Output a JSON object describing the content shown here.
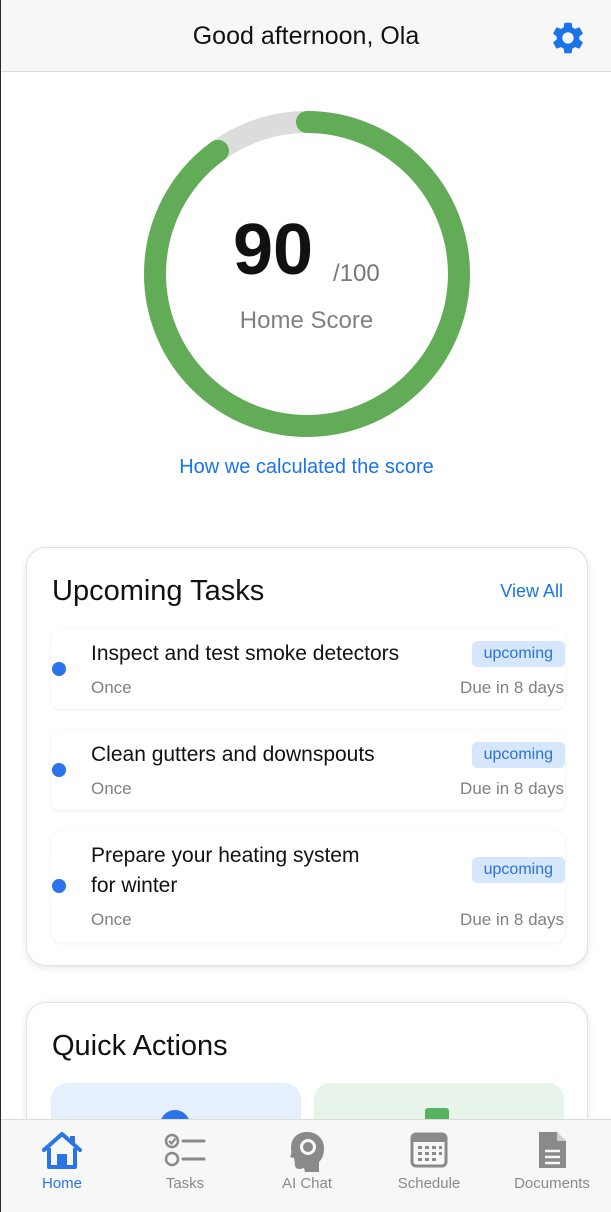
{
  "header": {
    "title": "Good afternoon, Ola",
    "settings_icon": "gear-icon"
  },
  "score": {
    "value": "90",
    "max_label": "/100",
    "label": "Home Score",
    "fraction": 0.9,
    "link": "How we calculated the score"
  },
  "colors": {
    "accent": "#1a73e8",
    "score_green": "#62ac57",
    "track_gray": "#dcdcdc",
    "badge_bg": "#d6e6fb"
  },
  "upcoming": {
    "title": "Upcoming Tasks",
    "view_all": "View All",
    "tasks": [
      {
        "lines": [
          "Inspect and test smoke detectors"
        ],
        "frequency": "Once",
        "due": "Due in 8 days",
        "status": "upcoming"
      },
      {
        "lines": [
          "Clean gutters and downspouts"
        ],
        "frequency": "Once",
        "due": "Due in 8 days",
        "status": "upcoming"
      },
      {
        "lines": [
          "Prepare your heating system",
          "for winter"
        ],
        "frequency": "Once",
        "due": "Due in 8 days",
        "status": "upcoming"
      }
    ]
  },
  "quick_actions": {
    "title": "Quick Actions"
  },
  "tabbar": {
    "tabs": [
      {
        "label": "Home",
        "icon": "home-icon",
        "active": true
      },
      {
        "label": "Tasks",
        "icon": "tasks-icon",
        "active": false
      },
      {
        "label": "AI Chat",
        "icon": "brain-icon",
        "active": false
      },
      {
        "label": "Schedule",
        "icon": "calendar-icon",
        "active": false
      },
      {
        "label": "Documents",
        "icon": "document-icon",
        "active": false
      }
    ]
  }
}
